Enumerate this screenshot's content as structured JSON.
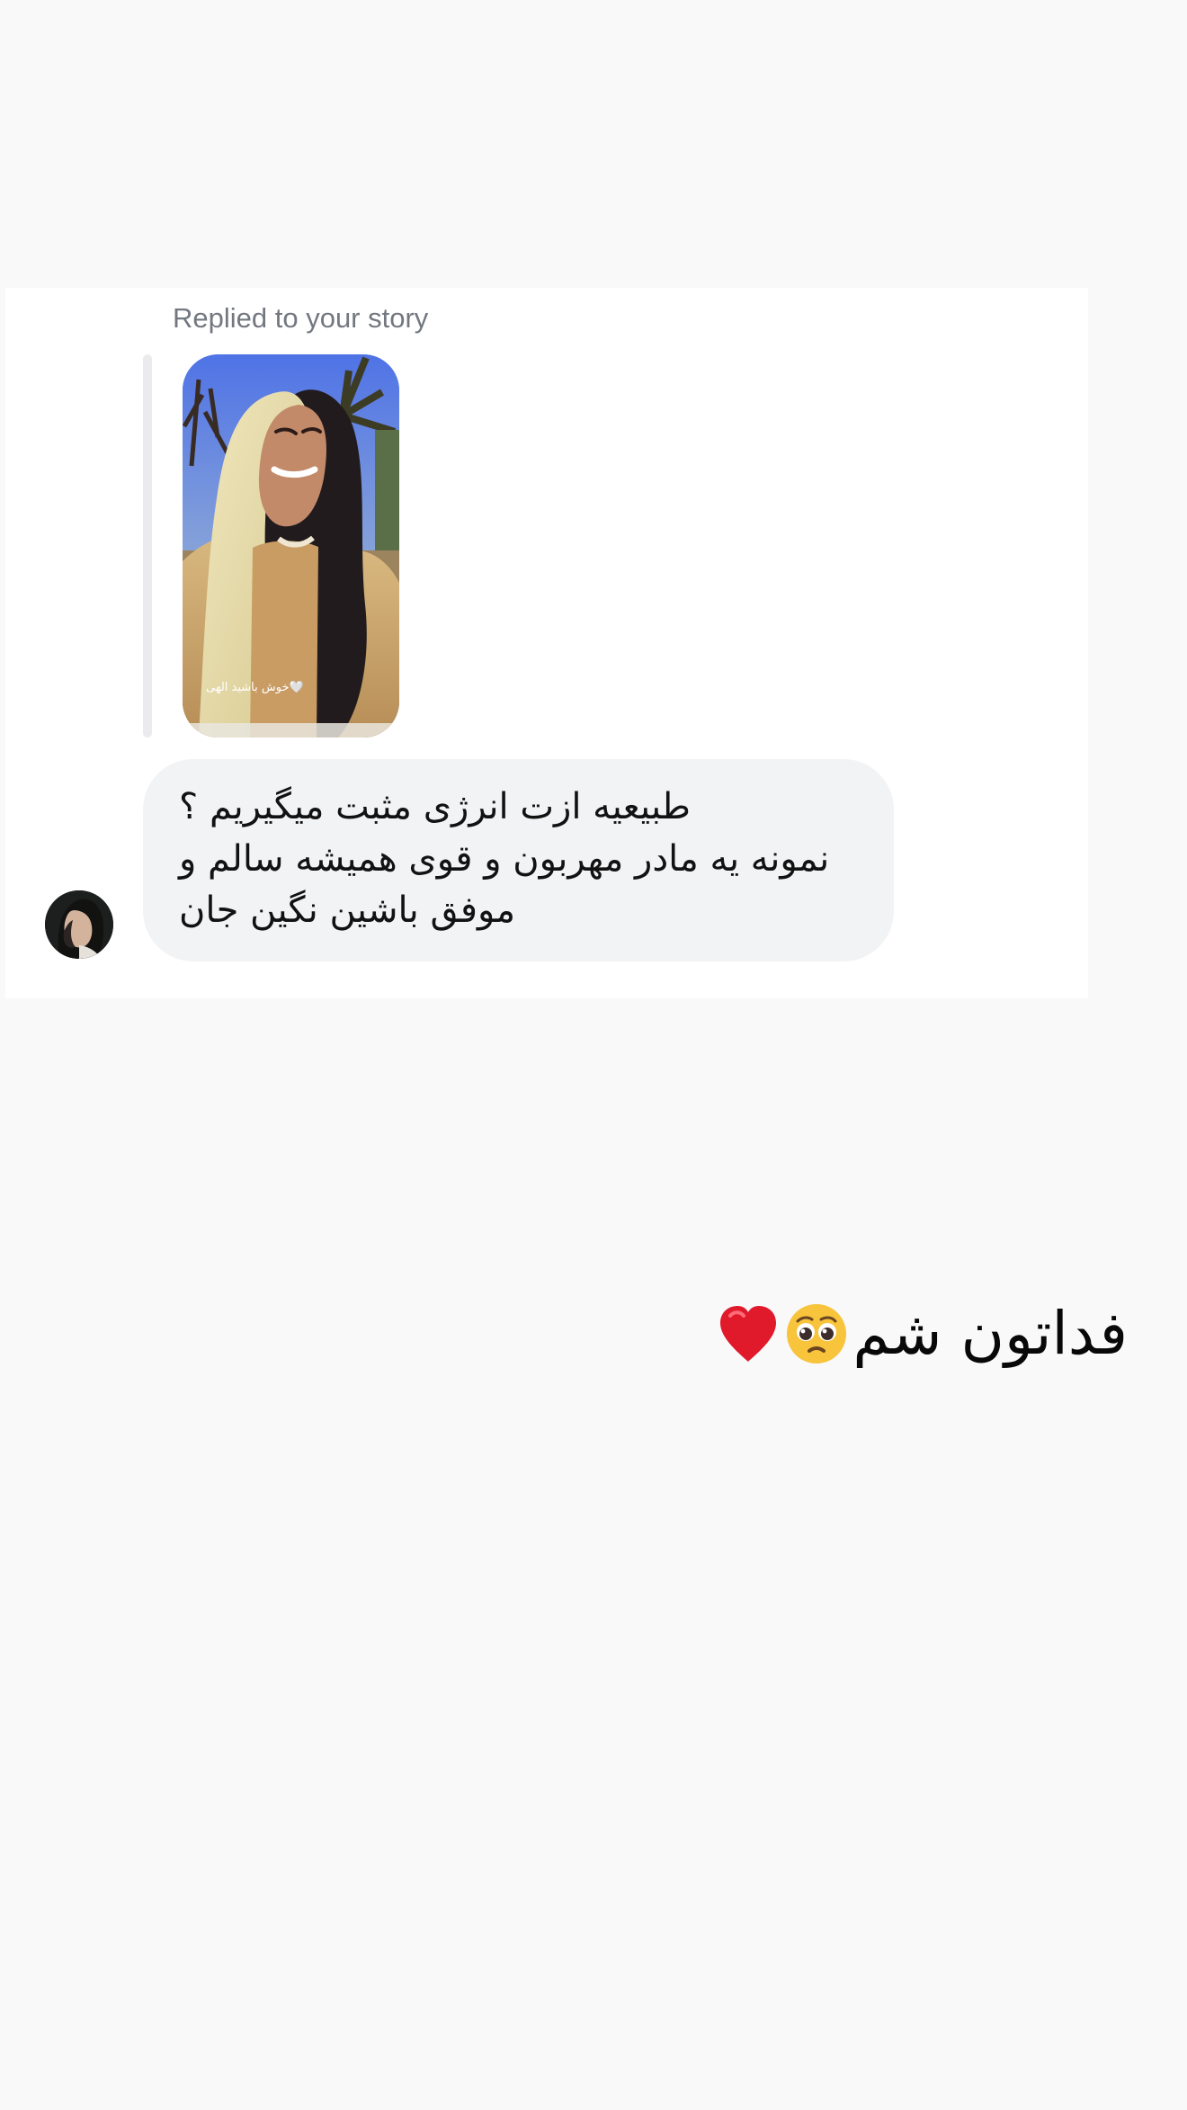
{
  "conversation": {
    "story_reply": {
      "label": "Replied to your story",
      "story_caption": "خوش باشید الهی🤍"
    },
    "incoming_message": {
      "lines": [
        "طبیعیه ازت انرژی مثبت میگیریم ؟",
        "نمونه یه مادر مهربون و قوی  همیشه سالم و",
        "موفق باشین نگین جان"
      ]
    },
    "outgoing_message": {
      "text": "فداتون شم",
      "emojis": [
        "pleading-face",
        "red-heart"
      ]
    }
  },
  "colors": {
    "page_background": "#f9f9fa",
    "card_background": "#ffffff",
    "incoming_bubble": "#f2f3f5",
    "meta_text": "#737880",
    "heart": "#e0192b",
    "emoji_face": "#f7c43b"
  }
}
